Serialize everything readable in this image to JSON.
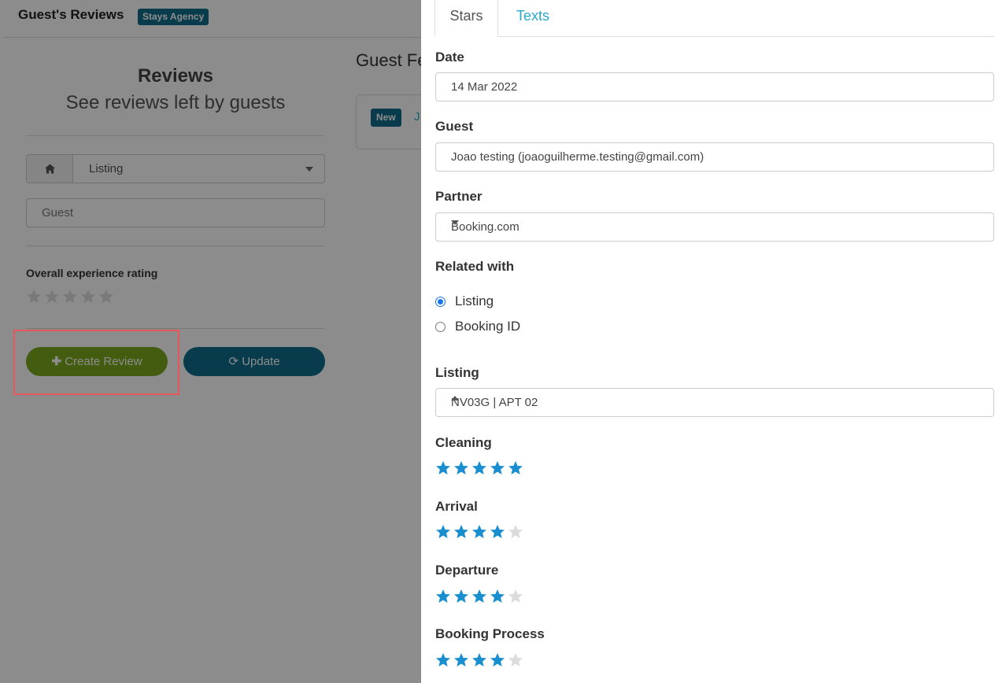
{
  "header": {
    "title": "Guest's Reviews",
    "badge": "Stays Agency"
  },
  "left": {
    "title": "Reviews",
    "subtitle": "See reviews left by guests",
    "listing_select": "Listing",
    "guest_placeholder": "Guest",
    "rating_label": "Overall experience rating",
    "overall_rating": 0,
    "create_button": "Create Review",
    "update_button": "Update"
  },
  "feed": {
    "title": "Guest Fe",
    "new_badge": "New",
    "link_fragment": "J"
  },
  "panel": {
    "tabs": [
      {
        "label": "Stars",
        "active": true
      },
      {
        "label": "Texts",
        "active": false
      }
    ],
    "date": {
      "label": "Date",
      "value": "14 Mar 2022"
    },
    "guest": {
      "label": "Guest",
      "value": "Joao testing (joaoguilherme.testing@gmail.com)"
    },
    "partner": {
      "label": "Partner",
      "value": "Booking.com"
    },
    "related": {
      "label": "Related with",
      "options": [
        "Listing",
        "Booking ID"
      ],
      "selected": "Listing"
    },
    "listing": {
      "label": "Listing",
      "value": "NV03G | APT 02"
    },
    "ratings": [
      {
        "label": "Cleaning",
        "value": 5
      },
      {
        "label": "Arrival",
        "value": 4
      },
      {
        "label": "Departure",
        "value": 4
      },
      {
        "label": "Booking Process",
        "value": 4
      }
    ]
  },
  "colors": {
    "accent": "#0f6d8d",
    "create": "#7aa81d",
    "star_on": "#1a8fcf",
    "star_off": "#dcdcdc",
    "link": "#2aa8c9",
    "highlight": "#e8555a"
  }
}
